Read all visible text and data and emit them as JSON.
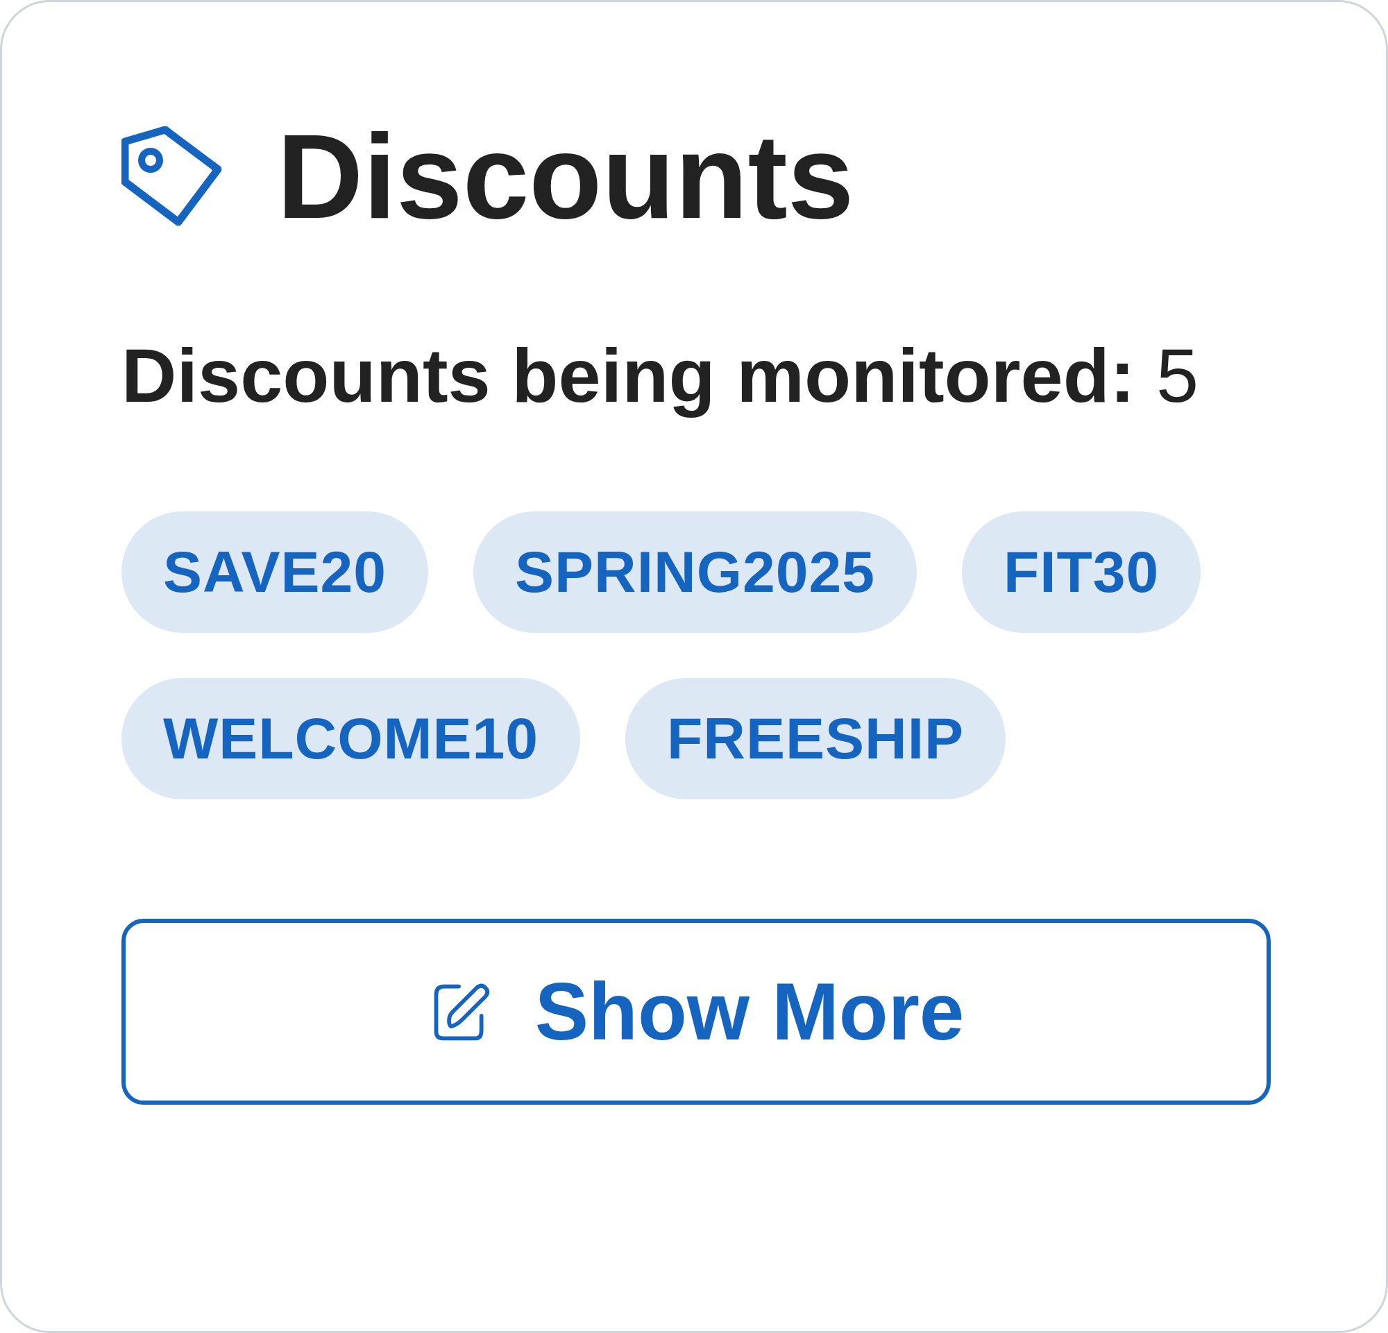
{
  "title": "Discounts",
  "summary": "**Discounts being monitored:** 5",
  "codes": [
    {
      "label": "SAVE20"
    },
    {
      "label": "SPRING2025"
    },
    {
      "label": "FIT30"
    },
    {
      "label": "WELCOME10"
    },
    {
      "label": "FREESHIP"
    }
  ],
  "button": {
    "label": "Show More"
  }
}
